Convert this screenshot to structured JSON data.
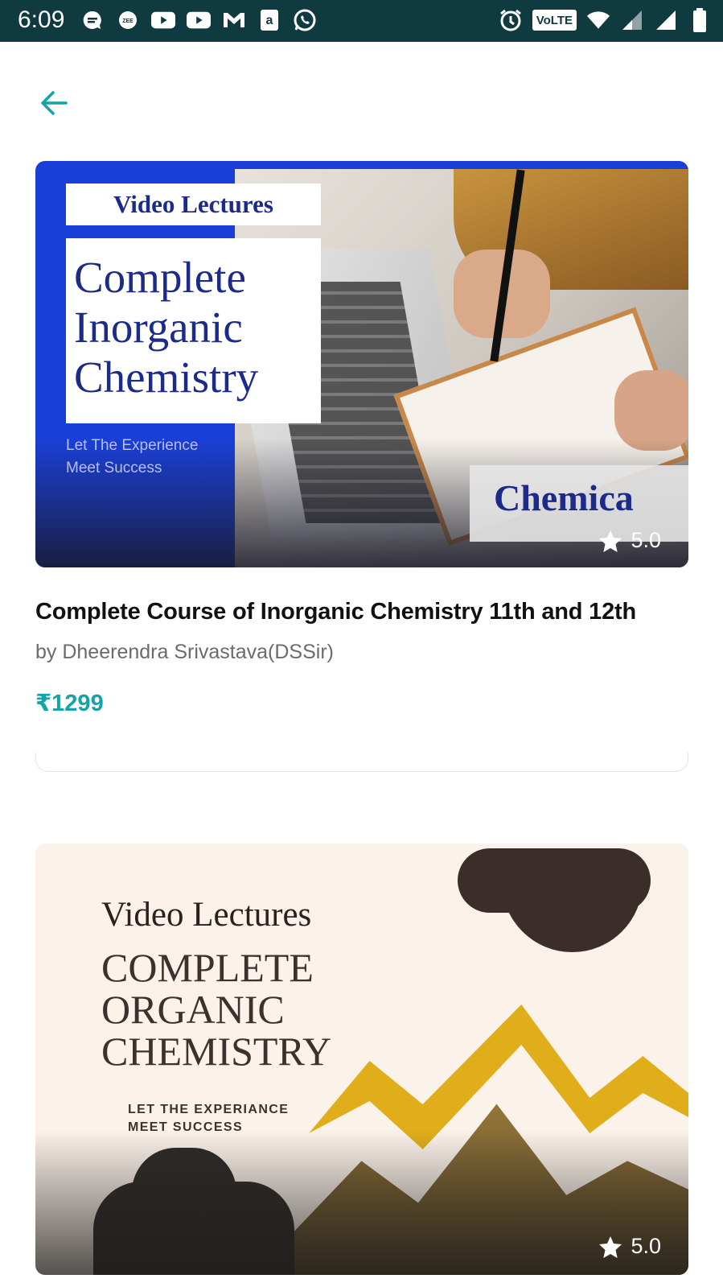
{
  "status_bar": {
    "time": "6:09",
    "volte": "VoLTE",
    "left_icons": [
      "message-icon",
      "zee5-icon",
      "youtube-icon",
      "youtube-icon",
      "gmail-icon",
      "amazon-icon",
      "whatsapp-icon"
    ],
    "right_icons": [
      "alarm-icon",
      "volte-icon",
      "wifi-icon",
      "signal-icon",
      "signal-icon",
      "battery-icon"
    ]
  },
  "nav": {
    "back_icon": "arrow-left-icon"
  },
  "courses": [
    {
      "thumb_tag": "Video Lectures",
      "thumb_title_lines": [
        "Complete",
        "Inorganic",
        "Chemistry"
      ],
      "thumb_sub_lines": [
        "Let The Experience",
        "Meet Success"
      ],
      "thumb_brand": "Chemica",
      "rating": "5.0",
      "title": "Complete Course of Inorganic Chemistry 11th and 12th",
      "author": "by Dheerendra Srivastava(DSSir)",
      "price": "₹1299"
    },
    {
      "thumb_tag": "Video Lectures",
      "thumb_title_lines": [
        "COMPLETE",
        "ORGANIC",
        "CHEMISTRY"
      ],
      "thumb_sub_lines": [
        "LET THE EXPERIANCE",
        "MEET SUCCESS"
      ],
      "rating": "5.0"
    }
  ],
  "colors": {
    "accent": "#13a3a9",
    "status_bar": "#0e3a40"
  }
}
